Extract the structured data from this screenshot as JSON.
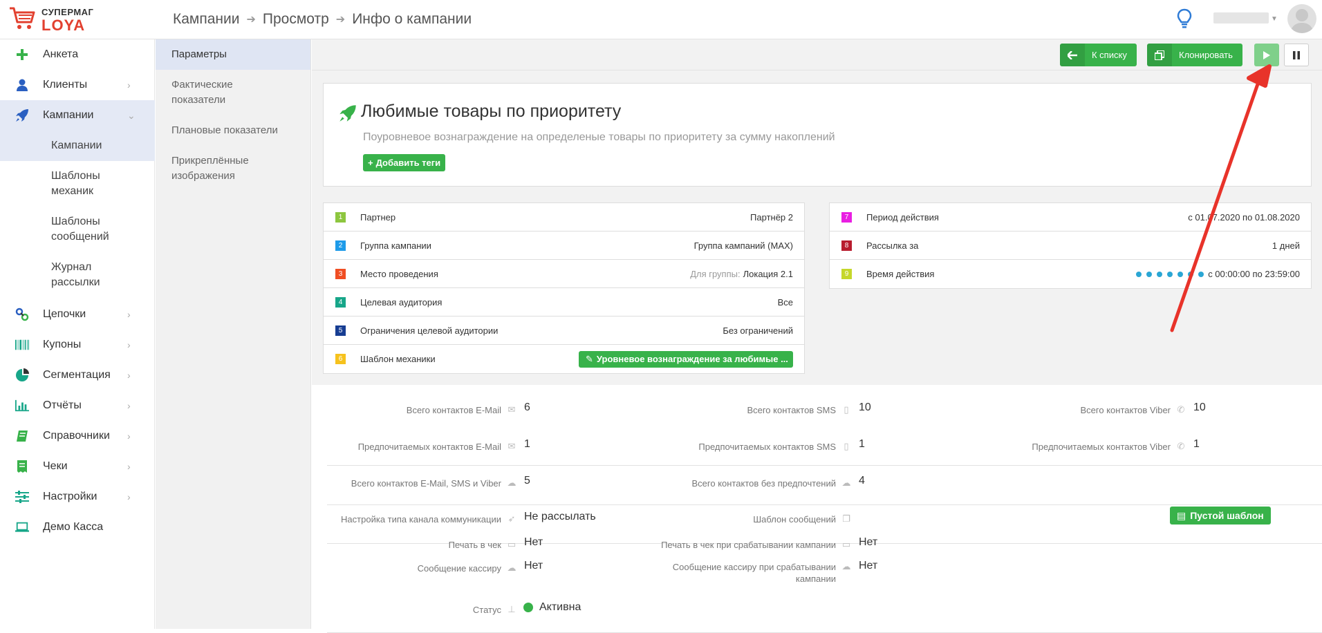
{
  "logo": {
    "line1": "СУПЕРМАГ",
    "line2": "LOYA"
  },
  "breadcrumb": {
    "b1": "Кампании",
    "b2": "Просмотр",
    "b3": "Инфо о кампании"
  },
  "sidebar": {
    "items": [
      {
        "label": "Анкета",
        "icon": "plus-icon"
      },
      {
        "label": "Клиенты",
        "icon": "user-icon"
      },
      {
        "label": "Кампании",
        "icon": "rocket-icon"
      },
      {
        "label": "Цепочки",
        "icon": "chain-icon"
      },
      {
        "label": "Купоны",
        "icon": "barcode-icon"
      },
      {
        "label": "Сегментация",
        "icon": "pie-icon"
      },
      {
        "label": "Отчёты",
        "icon": "bar-chart-icon"
      },
      {
        "label": "Справочники",
        "icon": "book-icon"
      },
      {
        "label": "Чеки",
        "icon": "receipt-icon"
      },
      {
        "label": "Настройки",
        "icon": "sliders-icon"
      },
      {
        "label": "Демо Касса",
        "icon": "laptop-icon"
      }
    ],
    "sub": [
      "Кампании",
      "Шаблоны механик",
      "Шаблоны сообщений",
      "Журнал рассылки"
    ]
  },
  "subnav": [
    "Параметры",
    "Фактические показатели",
    "Плановые показатели",
    "Прикреплённые изображения"
  ],
  "toolbar": {
    "back_label": "К списку",
    "clone_label": "Клонировать"
  },
  "campaign": {
    "title": "Любимые товары по приоритету",
    "subtitle": "Поуровневое вознаграждение на определеные товары по приоритету за сумму накоплений",
    "add_tags": "Добавить теги"
  },
  "params_left": [
    {
      "num": "1",
      "label": "Партнер",
      "value": "Партнёр 2",
      "color": "#8dc63f"
    },
    {
      "num": "2",
      "label": "Группа кампании",
      "value": "Группа кампаний (MAX)",
      "color": "#1e9be9"
    },
    {
      "num": "3",
      "label": "Место проведения",
      "muted": "Для группы:",
      "value": "Локация 2.1",
      "color": "#f04e23"
    },
    {
      "num": "4",
      "label": "Целевая аудитория",
      "value": "Все",
      "color": "#17a689"
    },
    {
      "num": "5",
      "label": "Ограничения целевой аудитории",
      "value": "Без ограничений",
      "color": "#173d92"
    },
    {
      "num": "6",
      "label": "Шаблон механики",
      "value": "Уровневое вознаграждение за любимые ...",
      "color": "#f6c21d"
    }
  ],
  "params_right": [
    {
      "num": "7",
      "label": "Период действия",
      "value": "с 01.07.2020 по 01.08.2020",
      "color": "#e91ee2"
    },
    {
      "num": "8",
      "label": "Рассылка за",
      "value": "1 дней",
      "color": "#b81c2e"
    },
    {
      "num": "9",
      "label": "Время действия",
      "value": "с 00:00:00 по 23:59:00",
      "color": "#c5d72b"
    }
  ],
  "stats": {
    "email_total_label": "Всего контактов E-Mail",
    "email_total": "6",
    "sms_total_label": "Всего контактов SMS",
    "sms_total": "10",
    "viber_total_label": "Всего контактов Viber",
    "viber_total": "10",
    "email_pref_label": "Предпочитаемых контактов E-Mail",
    "email_pref": "1",
    "sms_pref_label": "Предпочитаемых контактов SMS",
    "sms_pref": "1",
    "viber_pref_label": "Предпочитаемых контактов Viber",
    "viber_pref": "1",
    "all_label": "Всего контактов E-Mail, SMS и Viber",
    "all": "5",
    "nopref_label": "Всего контактов без предпочтений",
    "nopref": "4",
    "channel_label": "Настройка типа канала коммуникации",
    "channel": "Не рассылать",
    "tmpl_label": "Шаблон сообщений",
    "tmpl": "Пустой шаблон",
    "print_label": "Печать в чек",
    "print": "Нет",
    "print_trig_label": "Печать в чек при срабатывании кампании",
    "print_trig": "Нет",
    "cashier_label": "Сообщение кассиру",
    "cashier": "Нет",
    "cashier_trig_label1": "Сообщение кассиру при срабатывании",
    "cashier_trig_label2": "кампании",
    "cashier_trig": "Нет",
    "status_label": "Статус",
    "status": "Активна"
  }
}
